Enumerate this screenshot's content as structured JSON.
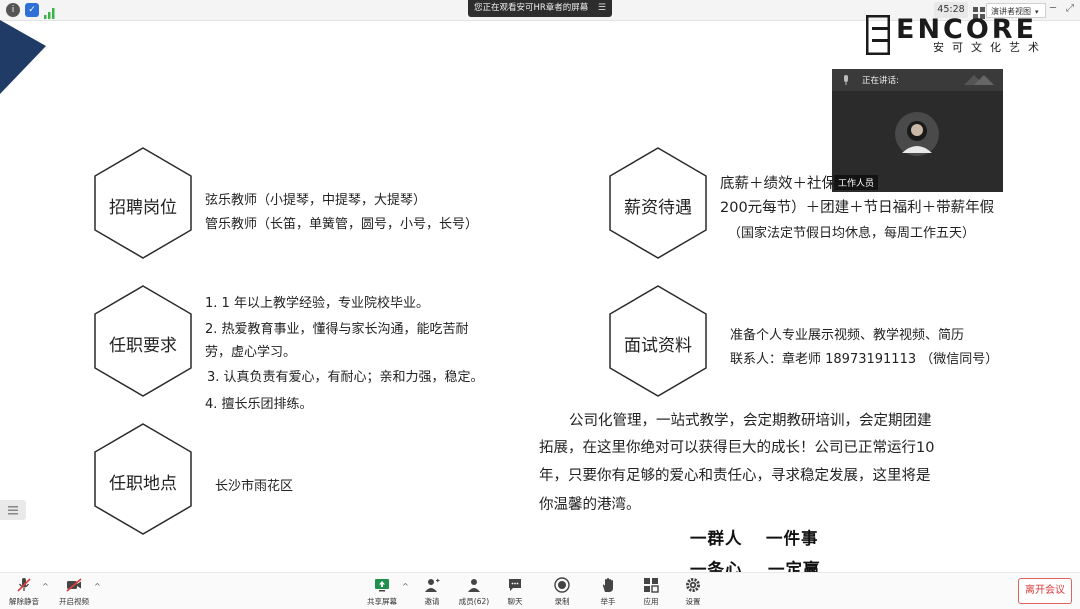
{
  "topbar": {
    "share_notice": "您正在观看安可HR章者的屏幕",
    "timer": "45:28",
    "view_mode": "演讲者视图"
  },
  "logo": {
    "text": "ENCORE",
    "subtitle": "安可文化艺术"
  },
  "video": {
    "speaking_label": "正在讲话:",
    "participant_name": "工作人员"
  },
  "sections": {
    "positions": {
      "title": "招聘岗位",
      "lines": [
        "弦乐教师（小提琴，中提琴，大提琴）",
        "管乐教师（长笛，单簧管，圆号，小号，长号）"
      ]
    },
    "requirements": {
      "title": "任职要求",
      "lines": [
        "1. 1 年以上教学经验，专业院校毕业。",
        "2. 热爱教育事业，懂得与家长沟通，能吃苦耐",
        "劳，虚心学习。",
        "3. 认真负责有爱心，有耐心；亲和力强，稳定。",
        "4. 擅长乐团排练。"
      ]
    },
    "location": {
      "title": "任职地点",
      "text": "长沙市雨花区"
    },
    "salary": {
      "title": "薪资待遇",
      "lines": [
        "底薪＋绩效＋社保",
        "200元每节）＋团建＋节日福利＋带薪年假",
        "（国家法定节假日均休息，每周工作五天）"
      ]
    },
    "interview": {
      "title": "面试资料",
      "lines": [
        "准备个人专业展示视频、教学视频、简历",
        "联系人：章老师   18973191113  （微信同号）"
      ]
    },
    "company_intro": [
      "公司化管理，一站式教学，会定期教研培训，会定期团建",
      "拓展，在这里你绝对可以获得巨大的成长！公司已正常运行10",
      "年，只要你有足够的爱心和责任心，寻求稳定发展，这里将是",
      "你温馨的港湾。"
    ],
    "slogan": [
      "一群人",
      "一件事",
      "一条心",
      "一定赢"
    ]
  },
  "toolbar": {
    "mute": "解除静音",
    "video": "开启视频",
    "share": "共享屏幕",
    "invite": "邀请",
    "members": "成员(62)",
    "chat": "聊天",
    "record": "录制",
    "raise_hand": "举手",
    "apps": "应用",
    "settings": "设置",
    "leave": "离开会议"
  }
}
